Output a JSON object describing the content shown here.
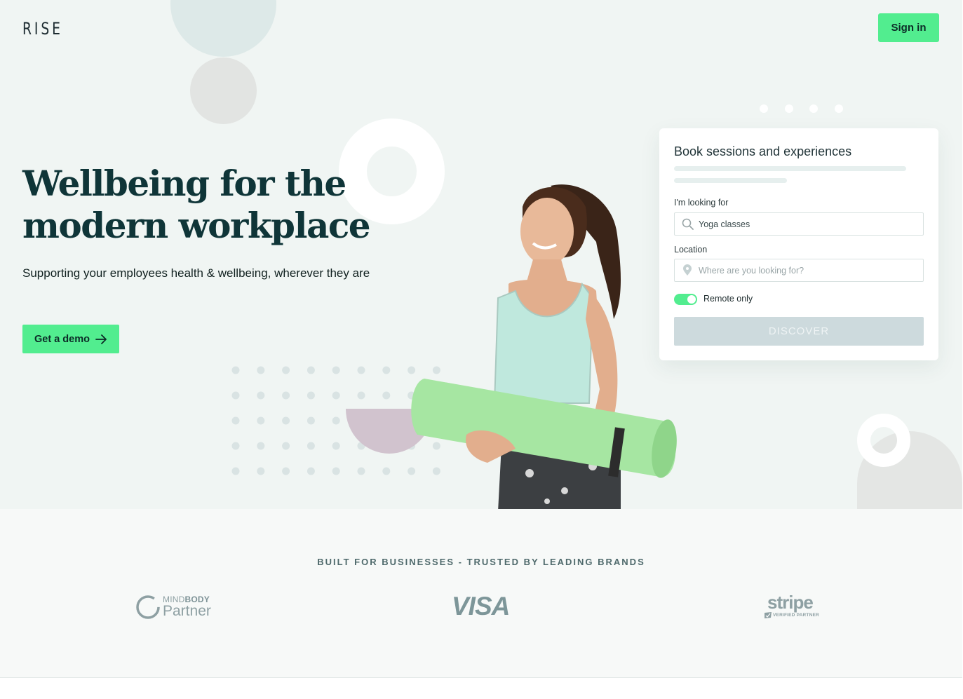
{
  "header": {
    "logo_text": "RISE",
    "signin_label": "Sign in"
  },
  "hero": {
    "headline_line1": "Wellbeing for the",
    "headline_line2": "modern workplace",
    "subheading": "Supporting your employees health & wellbeing, wherever they are",
    "demo_label": "Get a demo"
  },
  "booking_card": {
    "title": "Book sessions and experiences",
    "looking_for_label": "I'm looking for",
    "looking_for_value": "Yoga classes",
    "location_label": "Location",
    "location_placeholder": "Where are you looking for?",
    "remote_toggle_on": true,
    "remote_label": "Remote only",
    "discover_label": "DISCOVER"
  },
  "brands": {
    "title": "BUILT FOR BUSINESSES - TRUSTED BY LEADING BRANDS",
    "mindbody_top_light": "MIND",
    "mindbody_top_bold": "BODY",
    "mindbody_bottom": "Partner",
    "visa": "VISA",
    "stripe_word": "stripe",
    "stripe_sub": "VERIFIED PARTNER"
  },
  "colors": {
    "accent_green": "#52ed8f",
    "hero_bg": "#f0f5f3",
    "headline": "#0f3538",
    "discover_disabled": "#cddadd",
    "bowl_mauve": "#d1c3ce"
  },
  "icons": {
    "search": "search-icon",
    "location": "location-pin-icon",
    "arrow": "arrow-right-icon"
  }
}
